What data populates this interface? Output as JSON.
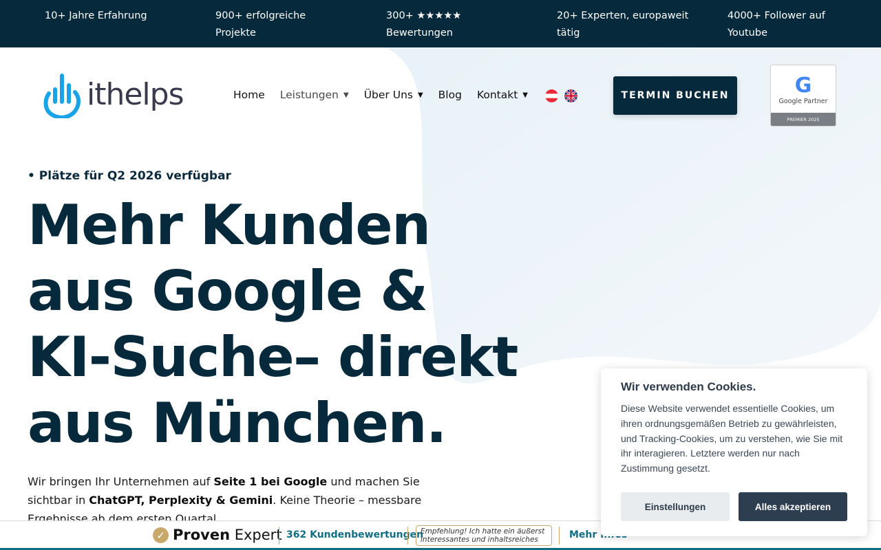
{
  "topbar": {
    "stats": [
      {
        "text": "10+ Jahre Erfahrung"
      },
      {
        "text": "900+ erfolgreiche Projekte"
      },
      {
        "text": "300+ ★★★★★ Bewertungen"
      },
      {
        "text": "20+ Experten, europaweit tätig"
      },
      {
        "text": "4000+ Follower auf Youtube"
      }
    ],
    "background": "#062a3b"
  },
  "header": {
    "logo_text": "ithelps",
    "nav": [
      {
        "label": "Home",
        "has_dropdown": false
      },
      {
        "label": "Leistungen",
        "has_dropdown": true
      },
      {
        "label": "Über Uns",
        "has_dropdown": true
      },
      {
        "label": "Blog",
        "has_dropdown": false
      },
      {
        "label": "Kontakt",
        "has_dropdown": true
      }
    ],
    "languages": [
      "austria-flag-icon",
      "uk-flag-icon"
    ],
    "cta_label": "TERMIN BUCHEN",
    "google_badge": {
      "title": "Google Partner",
      "tier": "PREMIER 2025"
    }
  },
  "hero": {
    "eyebrow": "• Plätze für Q2 2026 verfügbar",
    "headline": "Mehr Kunden aus Google & KI-Suche– direkt aus München.",
    "lead_parts": [
      {
        "text": "Wir bringen Ihr Unternehmen auf ",
        "bold": false
      },
      {
        "text": "Seite 1 bei Google",
        "bold": true
      },
      {
        "text": " und machen Sie sichtbar in ",
        "bold": false
      },
      {
        "text": "ChatGPT, Perplexity & Gemini",
        "bold": true
      },
      {
        "text": ". Keine Theorie – messbare Ergebnisse ab dem ersten Quartal.",
        "bold": false
      }
    ]
  },
  "proven_expert": {
    "brand_bold": "Proven",
    "brand_regular": " Expert",
    "reviews": "362 Kundenbewertungen",
    "quote": "Empfehlung! Ich hatte ein äußerst interessantes und inhaltsreiches ...",
    "more": "Mehr Infos"
  },
  "cookie": {
    "title": "Wir verwenden Cookies.",
    "text": "Diese Website verwendet essentielle Cookies, um ihren ordnungsgemäßen Betrieb zu gewährleisten, und Tracking-Cookies, um zu verstehen, wie Sie mit ihr interagieren. Letztere werden nur nach Zustimmung gesetzt.",
    "settings_label": "Einstellungen",
    "accept_label": "Alles akzeptieren"
  },
  "colors": {
    "brand_dark": "#062a3b",
    "logo_blue": "#1aa3e6",
    "proven_gold": "#c9a96b",
    "proven_teal": "#0e6f83"
  }
}
